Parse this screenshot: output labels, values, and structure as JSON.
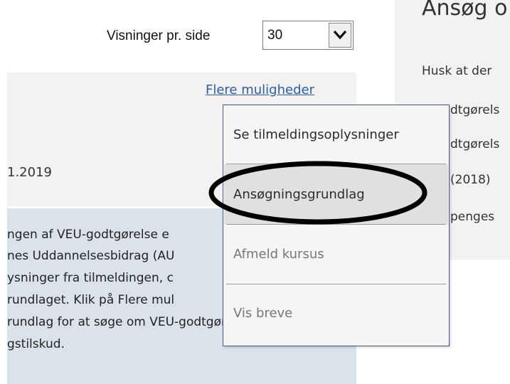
{
  "right_panel": {
    "heading": "Ansøg o",
    "lines": [
      "Husk at der",
      "dtgørels",
      "dtgørels",
      "(2018)",
      "penges"
    ]
  },
  "pagination": {
    "label": "Visninger pr. side",
    "selected_value": "30",
    "dropdown_icon": "chevron-down-icon"
  },
  "card": {
    "more_link": "Flere muligheder",
    "date": "1.2019"
  },
  "info_box": {
    "lines": [
      "ngen af VEU-godtgørelse e",
      "nes Uddannelsesbidrag (AU",
      "ysninger fra tilmeldingen, c",
      "rundlaget. Klik på Flere mul",
      "rundlag for at søge om VEU-godtgørelse",
      "gstilskud."
    ]
  },
  "menu": {
    "items": [
      {
        "label": "Se tilmeldingsoplysninger",
        "enabled": true
      },
      {
        "label": "Ansøgningsgrundlag",
        "enabled": true
      },
      {
        "label": "Afmeld kursus",
        "enabled": false
      },
      {
        "label": "Vis breve",
        "enabled": false
      }
    ]
  },
  "colors": {
    "link": "#2a5db0",
    "panel_bg": "#f3f2f1",
    "info_bg": "#dbe3ea",
    "menu_border": "#3d5a8a",
    "annotation": "#000000"
  }
}
